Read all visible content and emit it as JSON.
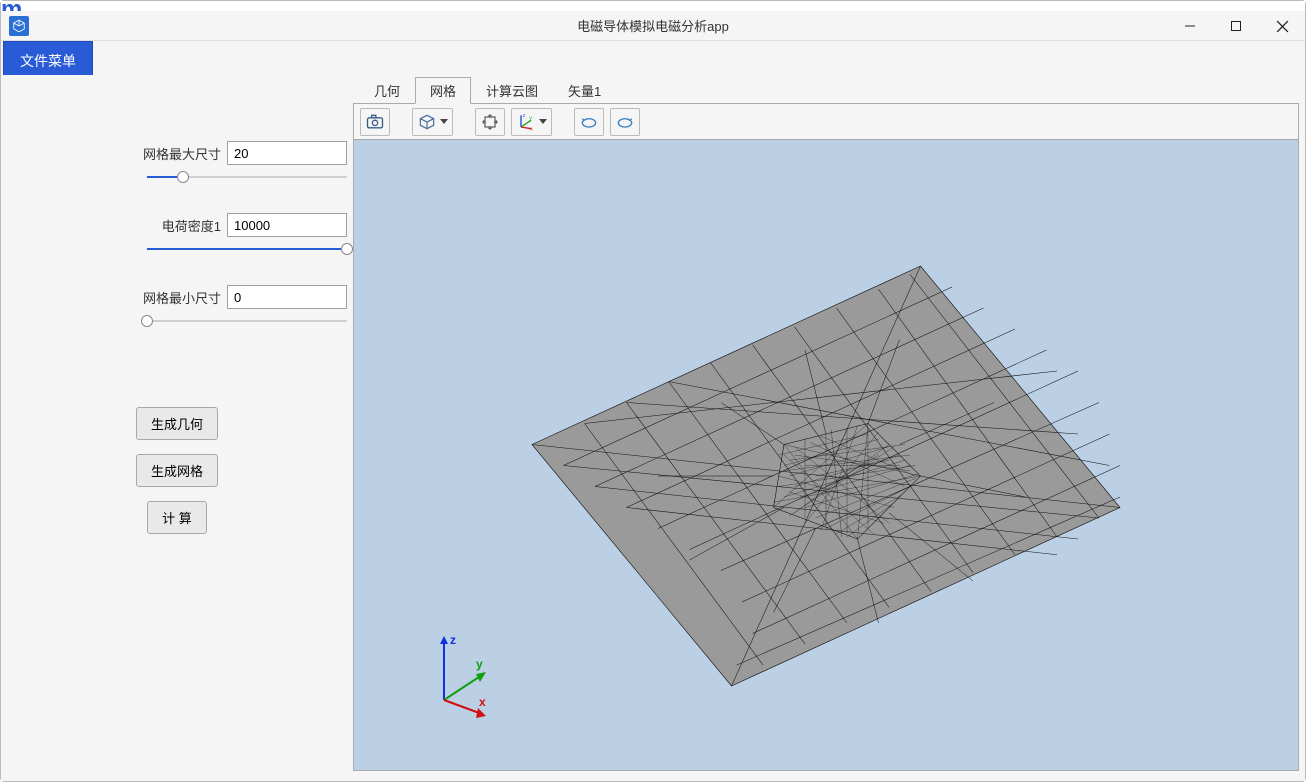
{
  "header": {
    "title": "电磁导体模拟电磁分析app"
  },
  "menubar": {
    "file_label": "文件菜单"
  },
  "params": {
    "mesh_max_label": "网格最大尺寸",
    "mesh_max_value": "20",
    "charge_density_label": "电荷密度1",
    "charge_density_value": "10000",
    "mesh_min_label": "网格最小尺寸",
    "mesh_min_value": "0"
  },
  "buttons": {
    "generate_geometry": "生成几何",
    "generate_mesh": "生成网格",
    "compute": "计 算"
  },
  "tabs": {
    "geometry": "几何",
    "mesh": "网格",
    "contour": "计算云图",
    "vector": "矢量1"
  },
  "axes": {
    "x": "x",
    "y": "y",
    "z": "z"
  }
}
